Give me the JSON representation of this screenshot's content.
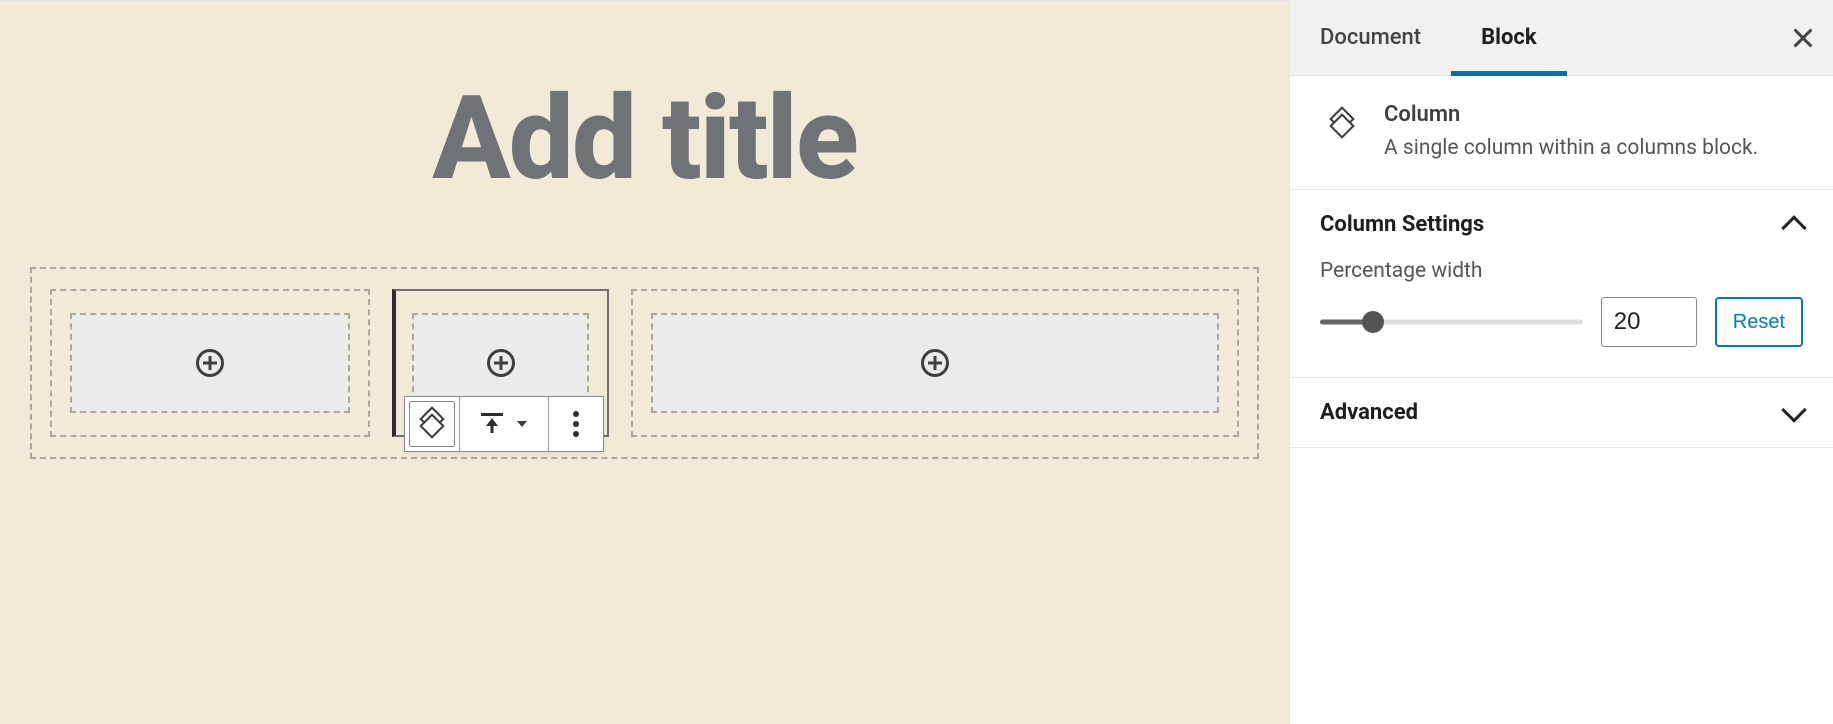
{
  "editor": {
    "title_placeholder": "Add title"
  },
  "toolbar": {
    "type_icon": "column-block",
    "align_icon": "vertical-align-top",
    "more_icon": "more-options"
  },
  "sidebar": {
    "tabs": {
      "document": "Document",
      "block": "Block"
    },
    "active_tab": "block",
    "block_card": {
      "title": "Column",
      "description": "A single column within a columns block."
    },
    "panels": {
      "column_settings": {
        "title": "Column Settings",
        "open": true,
        "percentage_label": "Percentage width",
        "percentage_value": "20",
        "reset_label": "Reset"
      },
      "advanced": {
        "title": "Advanced",
        "open": false
      }
    }
  }
}
